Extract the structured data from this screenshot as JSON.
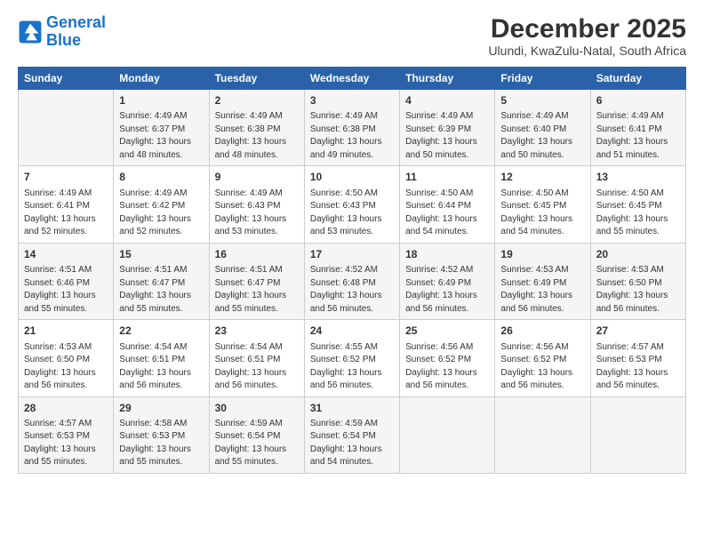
{
  "logo": {
    "line1": "General",
    "line2": "Blue"
  },
  "title": "December 2025",
  "subtitle": "Ulundi, KwaZulu-Natal, South Africa",
  "headers": [
    "Sunday",
    "Monday",
    "Tuesday",
    "Wednesday",
    "Thursday",
    "Friday",
    "Saturday"
  ],
  "rows": [
    [
      {
        "day": "",
        "lines": []
      },
      {
        "day": "1",
        "lines": [
          "Sunrise: 4:49 AM",
          "Sunset: 6:37 PM",
          "Daylight: 13 hours",
          "and 48 minutes."
        ]
      },
      {
        "day": "2",
        "lines": [
          "Sunrise: 4:49 AM",
          "Sunset: 6:38 PM",
          "Daylight: 13 hours",
          "and 48 minutes."
        ]
      },
      {
        "day": "3",
        "lines": [
          "Sunrise: 4:49 AM",
          "Sunset: 6:38 PM",
          "Daylight: 13 hours",
          "and 49 minutes."
        ]
      },
      {
        "day": "4",
        "lines": [
          "Sunrise: 4:49 AM",
          "Sunset: 6:39 PM",
          "Daylight: 13 hours",
          "and 50 minutes."
        ]
      },
      {
        "day": "5",
        "lines": [
          "Sunrise: 4:49 AM",
          "Sunset: 6:40 PM",
          "Daylight: 13 hours",
          "and 50 minutes."
        ]
      },
      {
        "day": "6",
        "lines": [
          "Sunrise: 4:49 AM",
          "Sunset: 6:41 PM",
          "Daylight: 13 hours",
          "and 51 minutes."
        ]
      }
    ],
    [
      {
        "day": "7",
        "lines": [
          "Sunrise: 4:49 AM",
          "Sunset: 6:41 PM",
          "Daylight: 13 hours",
          "and 52 minutes."
        ]
      },
      {
        "day": "8",
        "lines": [
          "Sunrise: 4:49 AM",
          "Sunset: 6:42 PM",
          "Daylight: 13 hours",
          "and 52 minutes."
        ]
      },
      {
        "day": "9",
        "lines": [
          "Sunrise: 4:49 AM",
          "Sunset: 6:43 PM",
          "Daylight: 13 hours",
          "and 53 minutes."
        ]
      },
      {
        "day": "10",
        "lines": [
          "Sunrise: 4:50 AM",
          "Sunset: 6:43 PM",
          "Daylight: 13 hours",
          "and 53 minutes."
        ]
      },
      {
        "day": "11",
        "lines": [
          "Sunrise: 4:50 AM",
          "Sunset: 6:44 PM",
          "Daylight: 13 hours",
          "and 54 minutes."
        ]
      },
      {
        "day": "12",
        "lines": [
          "Sunrise: 4:50 AM",
          "Sunset: 6:45 PM",
          "Daylight: 13 hours",
          "and 54 minutes."
        ]
      },
      {
        "day": "13",
        "lines": [
          "Sunrise: 4:50 AM",
          "Sunset: 6:45 PM",
          "Daylight: 13 hours",
          "and 55 minutes."
        ]
      }
    ],
    [
      {
        "day": "14",
        "lines": [
          "Sunrise: 4:51 AM",
          "Sunset: 6:46 PM",
          "Daylight: 13 hours",
          "and 55 minutes."
        ]
      },
      {
        "day": "15",
        "lines": [
          "Sunrise: 4:51 AM",
          "Sunset: 6:47 PM",
          "Daylight: 13 hours",
          "and 55 minutes."
        ]
      },
      {
        "day": "16",
        "lines": [
          "Sunrise: 4:51 AM",
          "Sunset: 6:47 PM",
          "Daylight: 13 hours",
          "and 55 minutes."
        ]
      },
      {
        "day": "17",
        "lines": [
          "Sunrise: 4:52 AM",
          "Sunset: 6:48 PM",
          "Daylight: 13 hours",
          "and 56 minutes."
        ]
      },
      {
        "day": "18",
        "lines": [
          "Sunrise: 4:52 AM",
          "Sunset: 6:49 PM",
          "Daylight: 13 hours",
          "and 56 minutes."
        ]
      },
      {
        "day": "19",
        "lines": [
          "Sunrise: 4:53 AM",
          "Sunset: 6:49 PM",
          "Daylight: 13 hours",
          "and 56 minutes."
        ]
      },
      {
        "day": "20",
        "lines": [
          "Sunrise: 4:53 AM",
          "Sunset: 6:50 PM",
          "Daylight: 13 hours",
          "and 56 minutes."
        ]
      }
    ],
    [
      {
        "day": "21",
        "lines": [
          "Sunrise: 4:53 AM",
          "Sunset: 6:50 PM",
          "Daylight: 13 hours",
          "and 56 minutes."
        ]
      },
      {
        "day": "22",
        "lines": [
          "Sunrise: 4:54 AM",
          "Sunset: 6:51 PM",
          "Daylight: 13 hours",
          "and 56 minutes."
        ]
      },
      {
        "day": "23",
        "lines": [
          "Sunrise: 4:54 AM",
          "Sunset: 6:51 PM",
          "Daylight: 13 hours",
          "and 56 minutes."
        ]
      },
      {
        "day": "24",
        "lines": [
          "Sunrise: 4:55 AM",
          "Sunset: 6:52 PM",
          "Daylight: 13 hours",
          "and 56 minutes."
        ]
      },
      {
        "day": "25",
        "lines": [
          "Sunrise: 4:56 AM",
          "Sunset: 6:52 PM",
          "Daylight: 13 hours",
          "and 56 minutes."
        ]
      },
      {
        "day": "26",
        "lines": [
          "Sunrise: 4:56 AM",
          "Sunset: 6:52 PM",
          "Daylight: 13 hours",
          "and 56 minutes."
        ]
      },
      {
        "day": "27",
        "lines": [
          "Sunrise: 4:57 AM",
          "Sunset: 6:53 PM",
          "Daylight: 13 hours",
          "and 56 minutes."
        ]
      }
    ],
    [
      {
        "day": "28",
        "lines": [
          "Sunrise: 4:57 AM",
          "Sunset: 6:53 PM",
          "Daylight: 13 hours",
          "and 55 minutes."
        ]
      },
      {
        "day": "29",
        "lines": [
          "Sunrise: 4:58 AM",
          "Sunset: 6:53 PM",
          "Daylight: 13 hours",
          "and 55 minutes."
        ]
      },
      {
        "day": "30",
        "lines": [
          "Sunrise: 4:59 AM",
          "Sunset: 6:54 PM",
          "Daylight: 13 hours",
          "and 55 minutes."
        ]
      },
      {
        "day": "31",
        "lines": [
          "Sunrise: 4:59 AM",
          "Sunset: 6:54 PM",
          "Daylight: 13 hours",
          "and 54 minutes."
        ]
      },
      {
        "day": "",
        "lines": []
      },
      {
        "day": "",
        "lines": []
      },
      {
        "day": "",
        "lines": []
      }
    ]
  ]
}
